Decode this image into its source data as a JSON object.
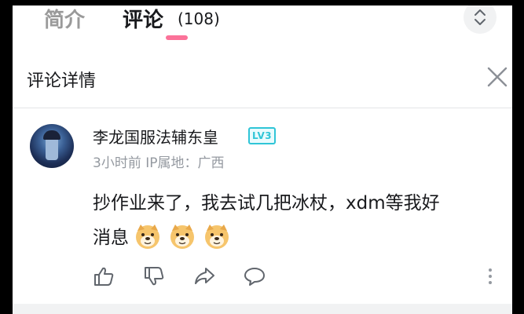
{
  "tabs": {
    "intro_label": "简介",
    "comments_label": "评论",
    "comments_count": "(108)"
  },
  "panel": {
    "title": "评论详情"
  },
  "comment": {
    "username": "李龙国服法辅东皇",
    "level_badge": "LV3",
    "meta": "3小时前 IP属地：广西",
    "content_line1": "抄作业来了，我去试几把冰杖，xdm等我好",
    "content_line2": "消息",
    "emojis": [
      "doge-emoji",
      "doge-emoji",
      "doge-emoji"
    ]
  },
  "icons": {
    "collapse": "chevron-up-down-icon",
    "close": "close-icon",
    "like": "thumbs-up-icon",
    "dislike": "thumbs-down-icon",
    "share": "share-icon",
    "reply": "comment-icon",
    "more": "more-vertical-icon"
  },
  "colors": {
    "accent_pink": "#fb7299",
    "level_cyan": "#2fc5d7",
    "text_primary": "#18191c",
    "text_secondary": "#9499a0"
  }
}
